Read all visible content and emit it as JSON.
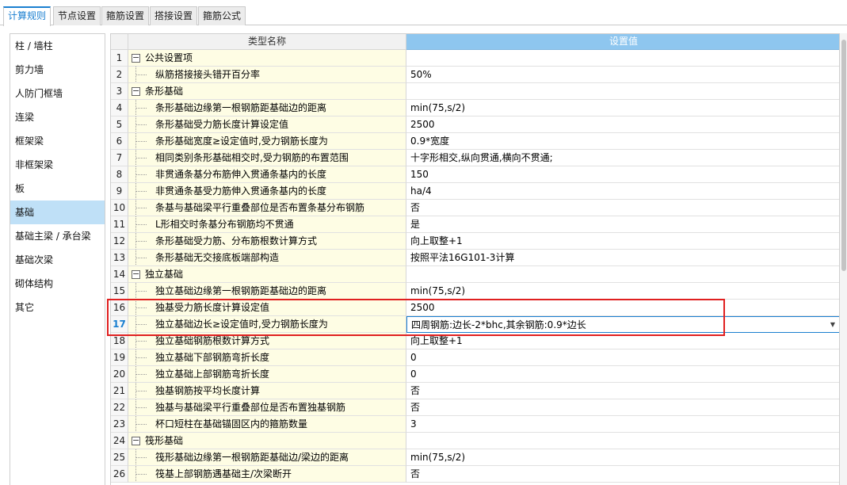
{
  "tabs": [
    {
      "label": "计算规则",
      "active": true
    },
    {
      "label": "节点设置",
      "active": false
    },
    {
      "label": "箍筋设置",
      "active": false
    },
    {
      "label": "搭接设置",
      "active": false
    },
    {
      "label": "箍筋公式",
      "active": false
    }
  ],
  "sidebar": {
    "items": [
      {
        "label": "柱 / 墙柱"
      },
      {
        "label": "剪力墙"
      },
      {
        "label": "人防门框墙"
      },
      {
        "label": "连梁"
      },
      {
        "label": "框架梁"
      },
      {
        "label": "非框架梁"
      },
      {
        "label": "板"
      },
      {
        "label": "基础",
        "selected": true
      },
      {
        "label": "基础主梁 / 承台梁"
      },
      {
        "label": "基础次梁"
      },
      {
        "label": "砌体结构"
      },
      {
        "label": "其它"
      }
    ]
  },
  "grid": {
    "header": {
      "name": "类型名称",
      "value": "设置值"
    },
    "rows": [
      {
        "num": "1",
        "name": "公共设置项",
        "value": "",
        "group": true
      },
      {
        "num": "2",
        "name": "纵筋搭接接头错开百分率",
        "value": "50%"
      },
      {
        "num": "3",
        "name": "条形基础",
        "value": "",
        "group": true
      },
      {
        "num": "4",
        "name": "条形基础边缘第一根钢筋距基础边的距离",
        "value": "min(75,s/2)"
      },
      {
        "num": "5",
        "name": "条形基础受力筋长度计算设定值",
        "value": "2500"
      },
      {
        "num": "6",
        "name": "条形基础宽度≥设定值时,受力钢筋长度为",
        "value": "0.9*宽度"
      },
      {
        "num": "7",
        "name": "相同类别条形基础相交时,受力钢筋的布置范围",
        "value": "十字形相交,纵向贯通,横向不贯通;"
      },
      {
        "num": "8",
        "name": "非贯通条基分布筋伸入贯通条基内的长度",
        "value": "150"
      },
      {
        "num": "9",
        "name": "非贯通条基受力筋伸入贯通条基内的长度",
        "value": "ha/4"
      },
      {
        "num": "10",
        "name": "条基与基础梁平行重叠部位是否布置条基分布钢筋",
        "value": "否"
      },
      {
        "num": "11",
        "name": "L形相交时条基分布钢筋均不贯通",
        "value": "是"
      },
      {
        "num": "12",
        "name": "条形基础受力筋、分布筋根数计算方式",
        "value": "向上取整+1"
      },
      {
        "num": "13",
        "name": "条形基础无交接底板端部构造",
        "value": "按照平法16G101-3计算"
      },
      {
        "num": "14",
        "name": "独立基础",
        "value": "",
        "group": true
      },
      {
        "num": "15",
        "name": "独立基础边缘第一根钢筋距基础边的距离",
        "value": "min(75,s/2)"
      },
      {
        "num": "16",
        "name": "独基受力筋长度计算设定值",
        "value": "2500"
      },
      {
        "num": "17",
        "name": "独立基础边长≥设定值时,受力钢筋长度为",
        "value": "四周钢筋:边长-2*bhc,其余钢筋:0.9*边长",
        "current": true
      },
      {
        "num": "18",
        "name": "独立基础钢筋根数计算方式",
        "value": "向上取整+1"
      },
      {
        "num": "19",
        "name": "独立基础下部钢筋弯折长度",
        "value": "0"
      },
      {
        "num": "20",
        "name": "独立基础上部钢筋弯折长度",
        "value": "0"
      },
      {
        "num": "21",
        "name": "独基钢筋按平均长度计算",
        "value": "否"
      },
      {
        "num": "22",
        "name": "独基与基础梁平行重叠部位是否布置独基钢筋",
        "value": "否"
      },
      {
        "num": "23",
        "name": "杯口短柱在基础锚固区内的箍筋数量",
        "value": "3"
      },
      {
        "num": "24",
        "name": "筏形基础",
        "value": "",
        "group": true
      },
      {
        "num": "25",
        "name": "筏形基础边缘第一根钢筋距基础边/梁边的距离",
        "value": "min(75,s/2)"
      },
      {
        "num": "26",
        "name": "筏基上部钢筋遇基础主/次梁断开",
        "value": "否"
      }
    ]
  },
  "icons": {
    "collapse": "minus-box-icon",
    "dropdown": "dropdown-arrow-icon"
  },
  "colors": {
    "accent": "#1a7fd0",
    "header_value_bg": "#8ec6ef",
    "name_cell_bg": "#fefde4",
    "highlight": "#e02020",
    "selected_sidebar": "#bfe0f7"
  }
}
